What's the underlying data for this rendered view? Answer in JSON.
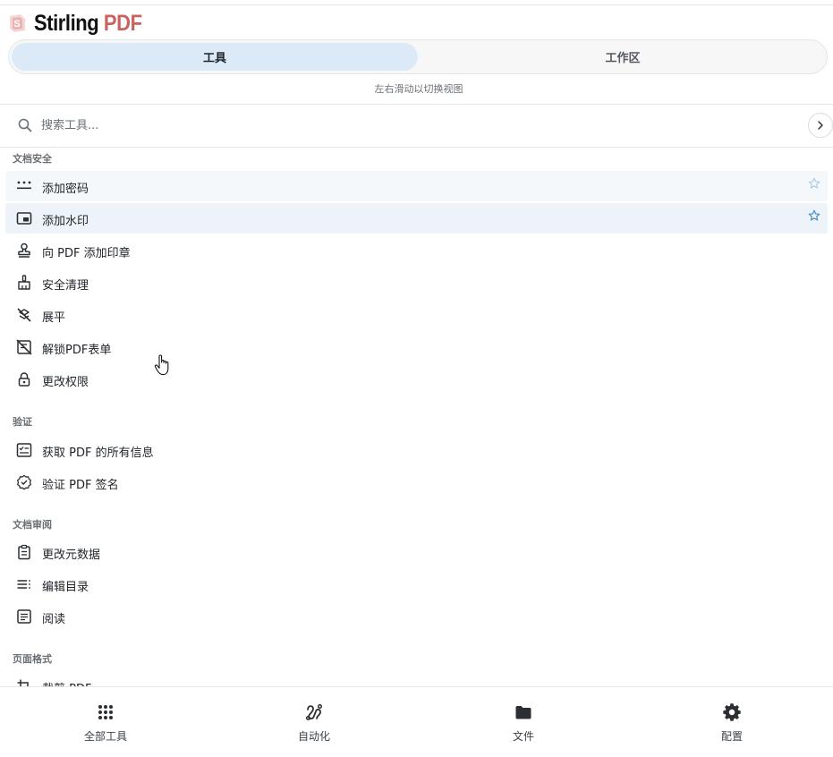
{
  "brand": {
    "name_part1": "Stirling",
    "name_part2": "PDF",
    "accent_color": "#c9635f"
  },
  "view_tabs": [
    {
      "label": "工具",
      "active": true
    },
    {
      "label": "工作区",
      "active": false
    }
  ],
  "swipe_hint": "左右滑动以切换视图",
  "search": {
    "placeholder": "搜索工具...",
    "value": ""
  },
  "tool_list": {
    "categories": [
      {
        "name": "文档安全",
        "items": [
          {
            "label": "添加密码",
            "icon": "password-icon",
            "favorite_star": true
          },
          {
            "label": "添加水印",
            "icon": "watermark-icon",
            "favorite_star": true
          },
          {
            "label": "向 PDF 添加印章",
            "icon": "stamp-icon"
          },
          {
            "label": "安全清理",
            "icon": "broom-icon"
          },
          {
            "label": "展平",
            "icon": "flatten-icon"
          },
          {
            "label": "解锁PDF表单",
            "icon": "unlock-form-icon"
          },
          {
            "label": "更改权限",
            "icon": "lock-icon"
          }
        ]
      },
      {
        "name": "验证",
        "items": [
          {
            "label": "获取 PDF 的所有信息",
            "icon": "info-list-icon"
          },
          {
            "label": "验证 PDF 签名",
            "icon": "verified-badge-icon"
          }
        ]
      },
      {
        "name": "文档审阅",
        "items": [
          {
            "label": "更改元数据",
            "icon": "clipboard-icon"
          },
          {
            "label": "编辑目录",
            "icon": "toc-list-icon"
          },
          {
            "label": "阅读",
            "icon": "article-icon"
          }
        ]
      },
      {
        "name": "页面格式",
        "items": [
          {
            "label": "裁剪 PDF",
            "icon": "crop-icon"
          }
        ]
      }
    ]
  },
  "bottom_nav": [
    {
      "label": "全部工具",
      "icon": "grid-dots-icon"
    },
    {
      "label": "自动化",
      "icon": "automation-icon"
    },
    {
      "label": "文件",
      "icon": "folder-icon"
    },
    {
      "label": "配置",
      "icon": "gear-icon"
    }
  ]
}
